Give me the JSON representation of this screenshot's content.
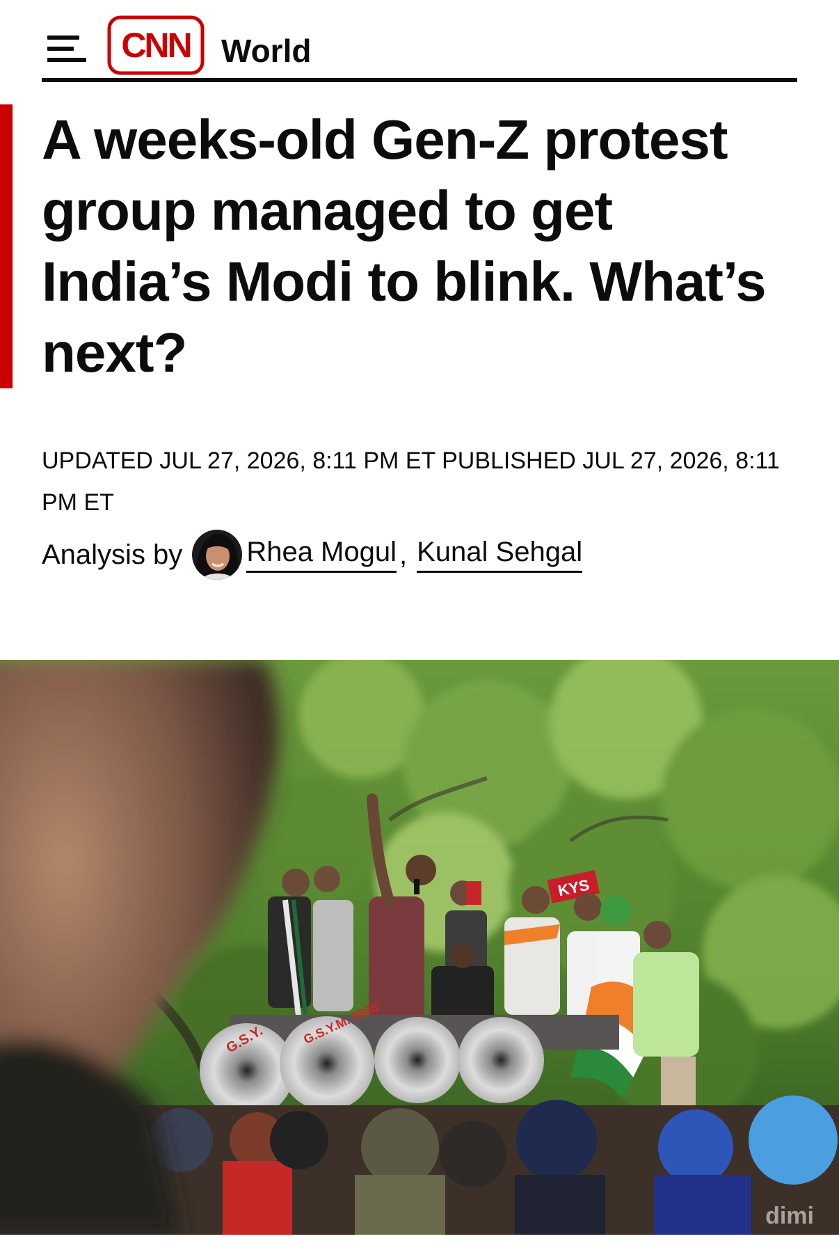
{
  "header": {
    "section_label": "World",
    "logo_text": "CNN",
    "menu_icon": "hamburger-menu-icon"
  },
  "article": {
    "headline": "A weeks-old Gen-Z protest group managed to get India’s Modi to blink. What’s next?",
    "timestamp": "UPDATED JUL 27, 2026, 8:11 PM ET PUBLISHED JUL 27, 2026, 8:11 PM ET",
    "byline": {
      "prefix": "Analysis by",
      "authors": [
        "Rhea Mogul",
        "Kunal Sehgal"
      ],
      "separator": ","
    }
  },
  "hero_image": {
    "sign_text": "KYS",
    "megaphone_text_1": "G.S.Y.",
    "megaphone_text_2": "G.S.Y.M. 9868",
    "watermark": "dimi"
  },
  "colors": {
    "brand_red": "#cc0000",
    "text": "#0c0c0c",
    "background": "#ffffff"
  }
}
